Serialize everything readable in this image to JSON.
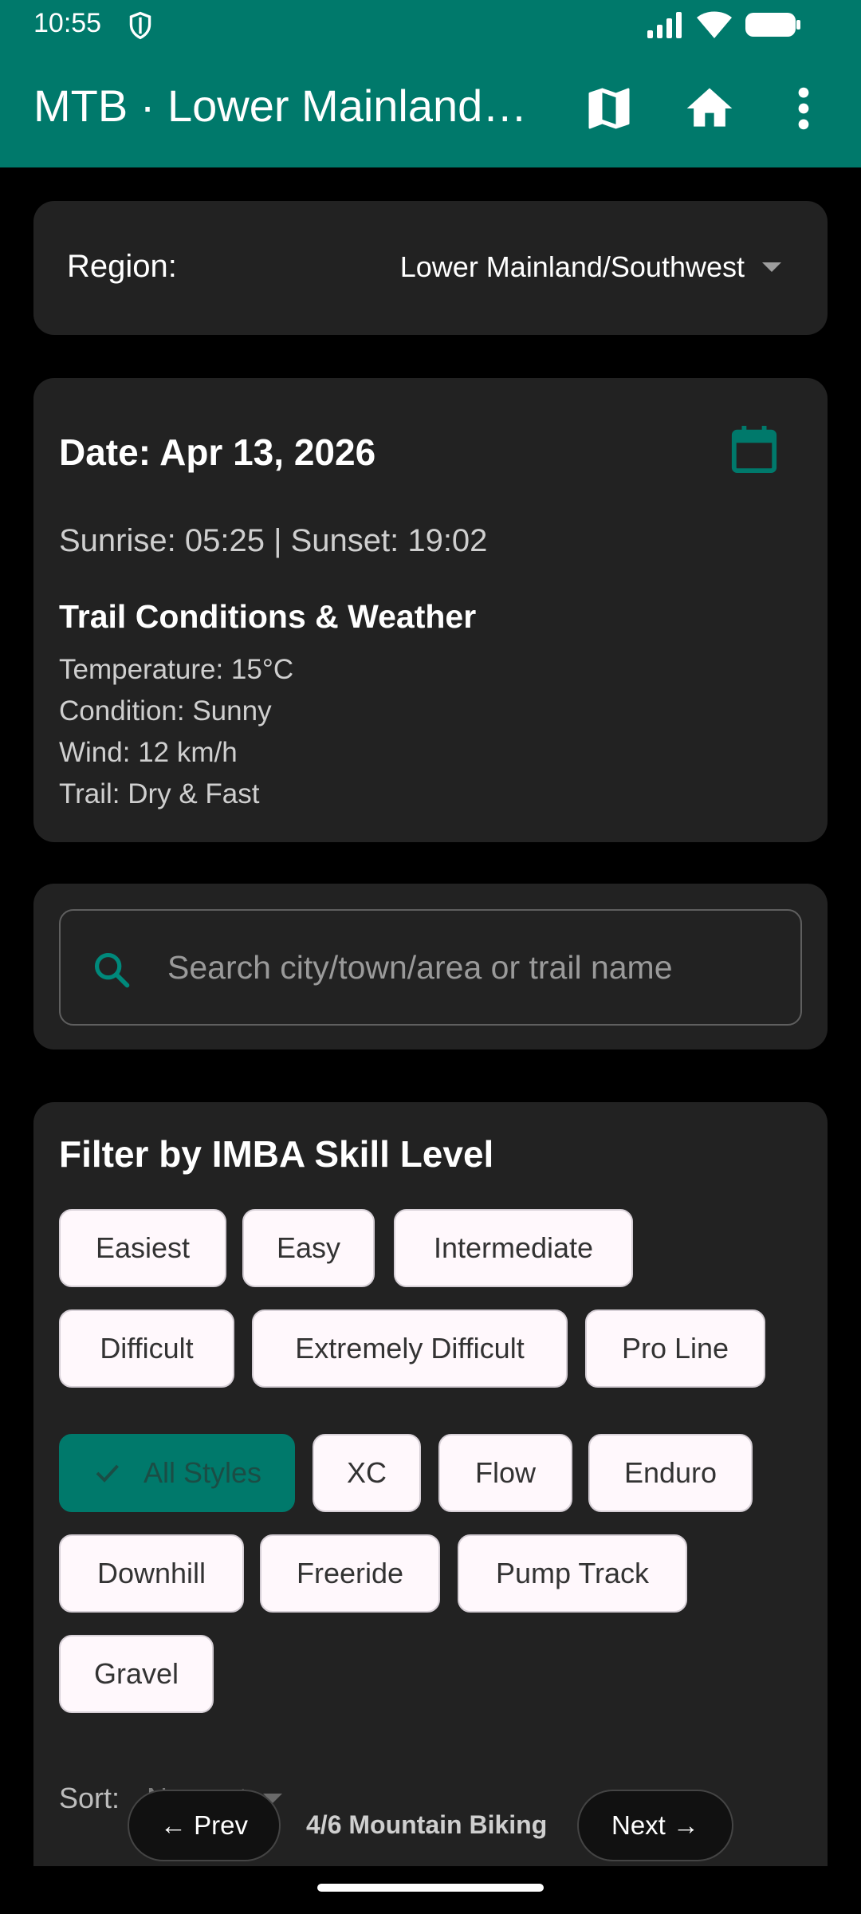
{
  "status_bar": {
    "time": "10:55"
  },
  "app_bar": {
    "title": "MTB · Lower Mainland…"
  },
  "region": {
    "label": "Region:",
    "selected": "Lower Mainland/Southwest"
  },
  "date_card": {
    "date": "Date: Apr 13, 2026",
    "sun_times": "Sunrise: 05:25 | Sunset: 19:02",
    "conditions_title": "Trail Conditions & Weather",
    "temperature": "Temperature: 15°C",
    "condition": "Condition: Sunny",
    "wind": "Wind: 12 km/h",
    "trail": "Trail: Dry & Fast"
  },
  "search": {
    "placeholder": "Search city/town/area or trail name",
    "value": ""
  },
  "filter": {
    "title": "Filter by IMBA Skill Level",
    "skill_levels": [
      "Easiest",
      "Easy",
      "Intermediate",
      "Difficult",
      "Extremely Difficult",
      "Pro Line"
    ],
    "styles": [
      "All Styles",
      "XC",
      "Flow",
      "Enduro",
      "Downhill",
      "Freeride",
      "Pump Track",
      "Gravel"
    ],
    "selected_style": "All Styles"
  },
  "sort": {
    "label": "Sort:",
    "value": "Nearest"
  },
  "pager": {
    "prev_label": "← Prev",
    "status": "4/6  Mountain Biking",
    "next_label": "Next →"
  },
  "colors": {
    "primary": "#00796B",
    "card": "#222222",
    "chip": "#FFF8FC"
  },
  "icons": [
    "shield-icon",
    "signal-icon",
    "wifi-icon",
    "battery-icon",
    "map-icon",
    "home-icon",
    "more-vert-icon",
    "calendar-icon",
    "search-icon",
    "check-icon"
  ]
}
